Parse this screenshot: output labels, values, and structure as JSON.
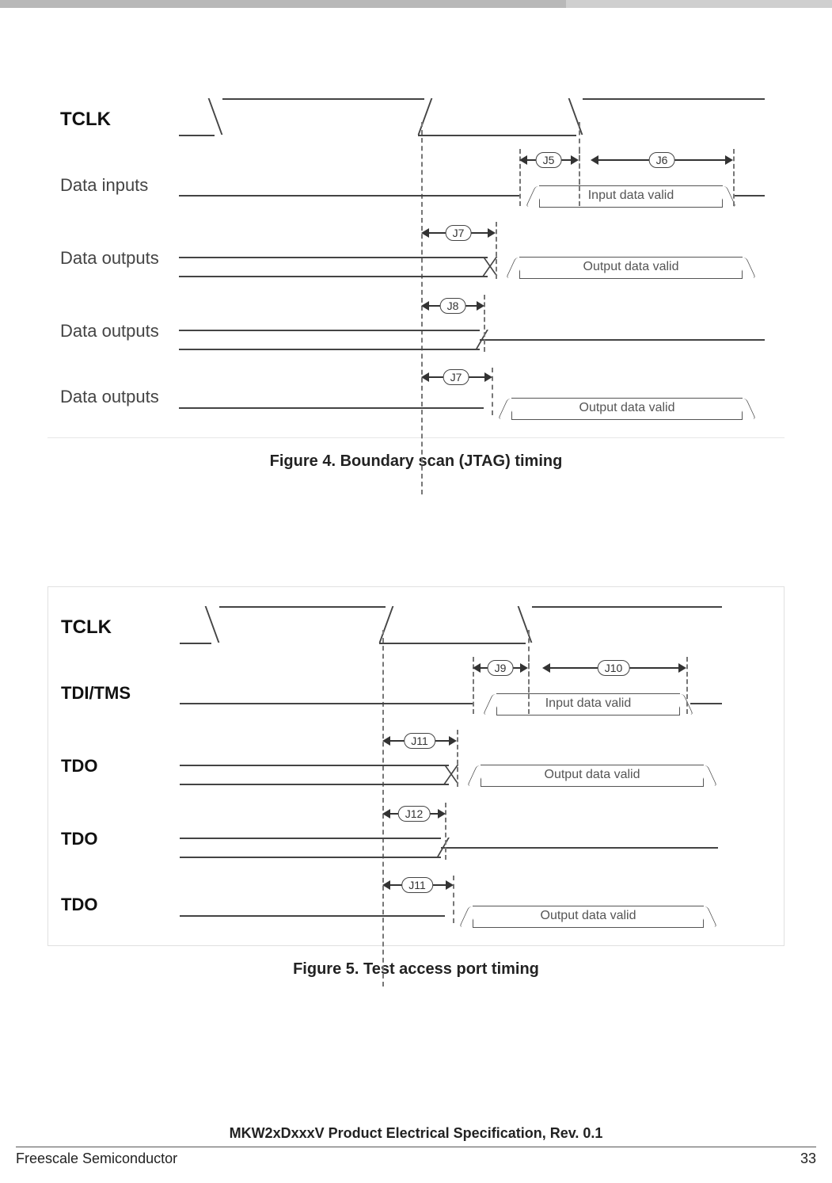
{
  "figure4": {
    "caption": "Figure 4. Boundary scan (JTAG) timing",
    "signals": {
      "tclk": "TCLK",
      "data_inputs": "Data inputs",
      "data_outputs": "Data outputs"
    },
    "labels": {
      "input_valid": "Input data valid",
      "output_valid": "Output data valid"
    },
    "markers": {
      "j5": "J5",
      "j6": "J6",
      "j7": "J7",
      "j8": "J8"
    }
  },
  "figure5": {
    "caption": "Figure 5. Test access port timing",
    "signals": {
      "tclk": "TCLK",
      "tdi_tms": "TDI/TMS",
      "tdo": "TDO"
    },
    "labels": {
      "input_valid": "Input data valid",
      "output_valid": "Output data valid"
    },
    "markers": {
      "j9": "J9",
      "j10": "J10",
      "j11": "J11",
      "j12": "J12"
    }
  },
  "footer": {
    "doc_title": "MKW2xDxxxV Product Electrical Specification, Rev. 0.1",
    "company": "Freescale Semiconductor",
    "page": "33"
  }
}
